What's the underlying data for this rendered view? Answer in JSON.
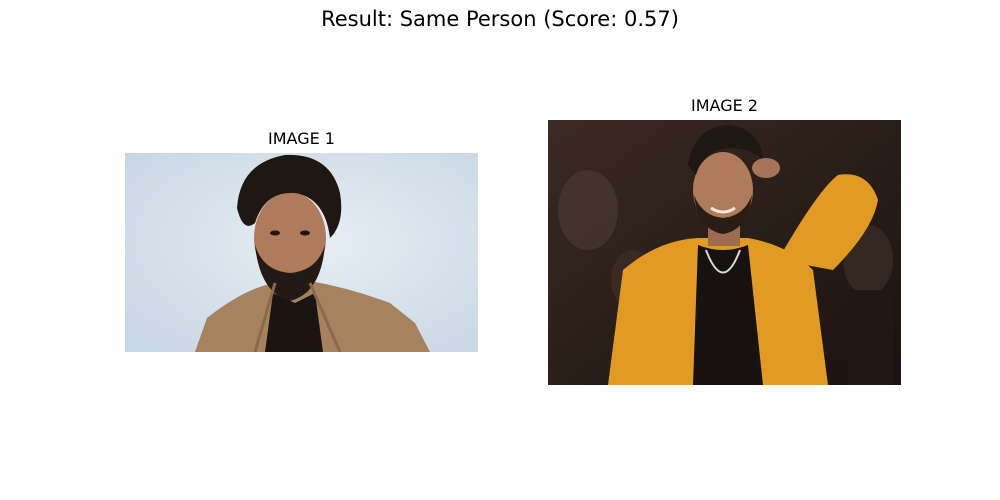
{
  "figure": {
    "suptitle": "Result: Same Person (Score: 0.57)"
  },
  "panels": [
    {
      "title": "IMAGE 1"
    },
    {
      "title": "IMAGE 2"
    }
  ],
  "colors": {
    "background": "#ffffff",
    "image1_backdrop": "#d6e3ee",
    "image1_jacket": "#a7825f",
    "image2_backdrop": "#2a1c16",
    "image2_jacket": "#e19a22",
    "hair": "#1f1712",
    "skin": "#b07a5c"
  }
}
